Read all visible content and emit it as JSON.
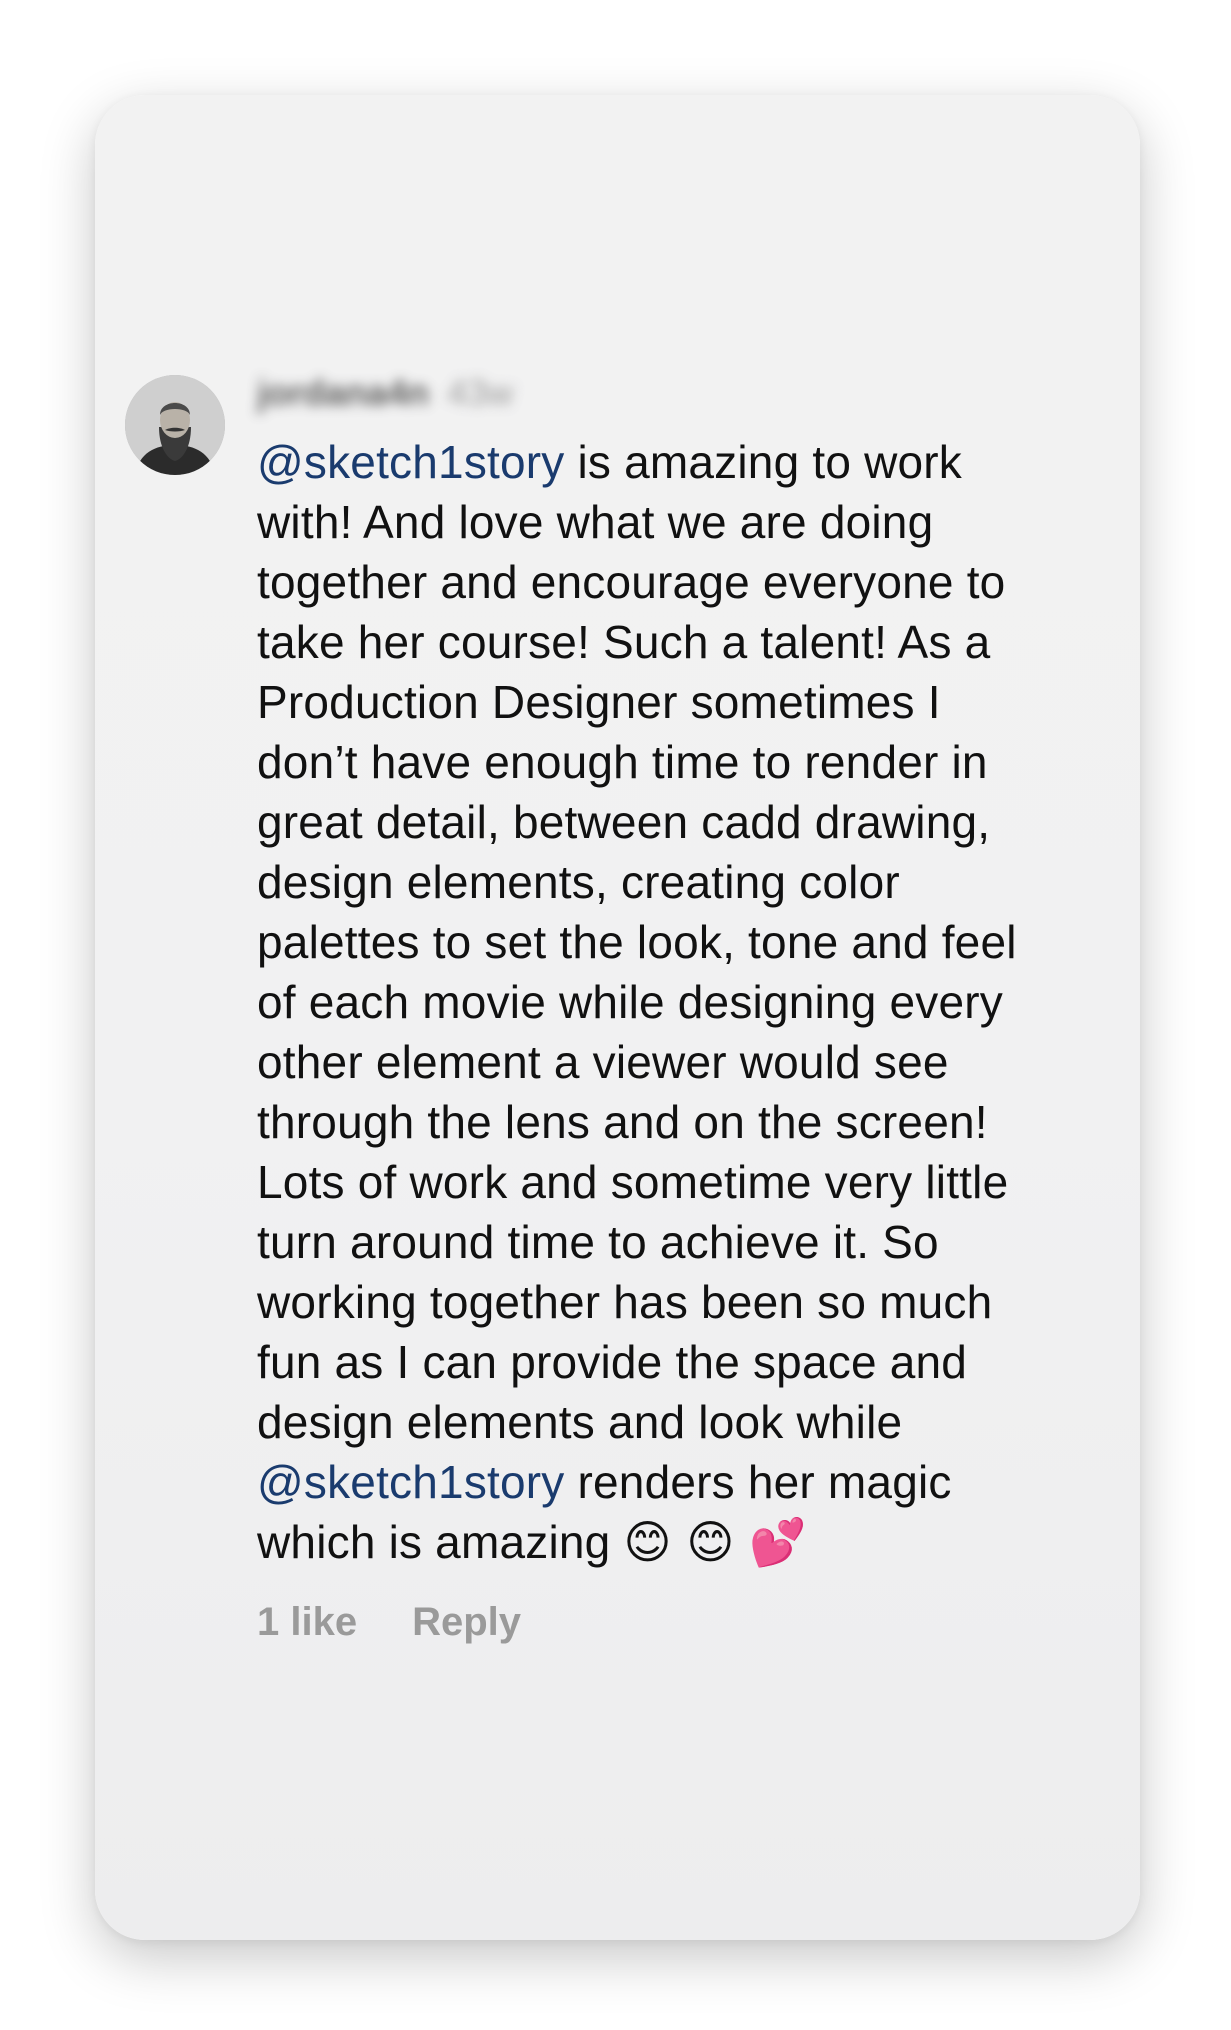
{
  "comment": {
    "author": {
      "username": "jordana4n",
      "timestamp": "43w",
      "avatar_icon": "person-avatar-icon"
    },
    "lines": [
      [
        {
          "t": "@sketch1story",
          "m": true
        },
        {
          "t": " is amazing to work"
        }
      ],
      [
        {
          "t": "with! And love what we are doing"
        }
      ],
      [
        {
          "t": "together and encourage everyone to"
        }
      ],
      [
        {
          "t": "take her course! Such a talent! As a"
        }
      ],
      [
        {
          "t": "Production Designer sometimes I"
        }
      ],
      [
        {
          "t": "don’t have enough time to render in"
        }
      ],
      [
        {
          "t": "great detail, between cadd drawing,"
        }
      ],
      [
        {
          "t": "design elements, creating color"
        }
      ],
      [
        {
          "t": "palettes to set the look, tone and feel"
        }
      ],
      [
        {
          "t": "of each movie while designing every"
        }
      ],
      [
        {
          "t": "other element a viewer would see"
        }
      ],
      [
        {
          "t": "through the lens and on the screen!"
        }
      ],
      [
        {
          "t": "Lots of work and sometime very little"
        }
      ],
      [
        {
          "t": "turn around time to achieve it. So"
        }
      ],
      [
        {
          "t": "working together has been so much"
        }
      ],
      [
        {
          "t": "fun as I can provide the space and"
        }
      ],
      [
        {
          "t": "design elements and look while"
        }
      ],
      [
        {
          "t": "@sketch1story",
          "m": true
        },
        {
          "t": " renders her magic"
        }
      ],
      [
        {
          "t": "which is amazing "
        },
        {
          "t": "😊 😊 💕",
          "e": true
        }
      ]
    ],
    "actions": {
      "likes_label": "1 like",
      "reply_label": "Reply"
    }
  },
  "colors": {
    "mention": "#1a3b6e",
    "text": "#111111",
    "meta": "#9a9a9a",
    "card_background": "#f2f2f2"
  }
}
